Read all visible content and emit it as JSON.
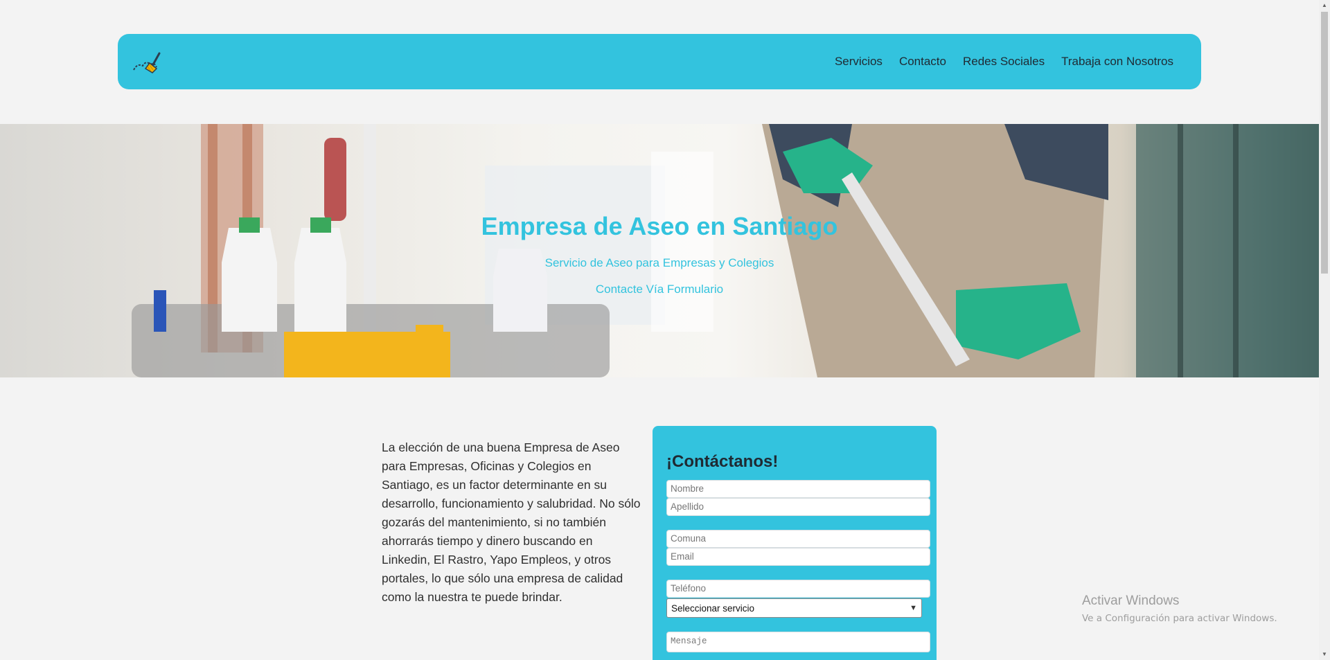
{
  "navbar": {
    "links": [
      "Servicios",
      "Contacto",
      "Redes Sociales",
      "Trabaja con Nosotros"
    ]
  },
  "hero": {
    "title": "Empresa de Aseo en Santiago",
    "subtitle": "Servicio de Aseo para Empresas y Colegios",
    "cta": "Contacte Vía Formulario"
  },
  "intro": {
    "text": "La elección de una buena Empresa de Aseo para Empresas, Oficinas y Colegios en Santiago, es un factor determinante en su desarrollo, funcionamiento y salubridad. No sólo gozarás del mantenimiento, si no también ahorrarás tiempo y dinero buscando en Linkedin, El Rastro, Yapo Empleos, y otros portales, lo que sólo una empresa de calidad como la nuestra te puede brindar."
  },
  "form": {
    "title": "¡Contáctanos!",
    "nombre_placeholder": "Nombre",
    "apellido_placeholder": "Apellido",
    "comuna_placeholder": "Comuna",
    "email_placeholder": "Email",
    "telefono_placeholder": "Teléfono",
    "servicio_selected": "Seleccionar servicio",
    "mensaje_placeholder": "Mensaje"
  },
  "watermark": {
    "title": "Activar Windows",
    "subtitle": "Ve a Configuración para activar Windows."
  },
  "colors": {
    "accent": "#33c3de",
    "background": "#f3f3f3",
    "text": "#2f2f2f"
  },
  "icons": {
    "logo": "broom-icon"
  }
}
